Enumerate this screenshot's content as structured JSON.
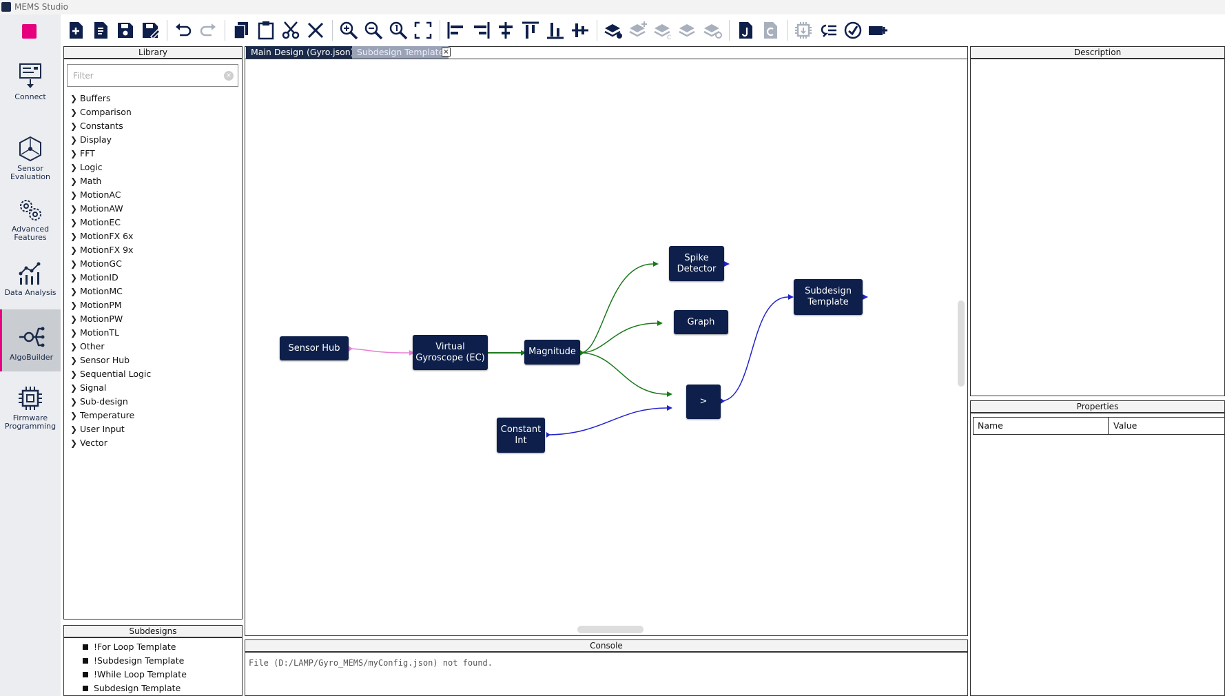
{
  "window": {
    "title": "MEMS Studio"
  },
  "nav": {
    "items": [
      {
        "label": "Connect",
        "icon": "connect-icon"
      },
      {
        "label": "Sensor Evaluation",
        "icon": "sensor-evaluation-icon"
      },
      {
        "label": "Advanced Features",
        "icon": "gears-icon"
      },
      {
        "label": "Data Analysis",
        "icon": "chart-icon"
      },
      {
        "label": "AlgoBuilder",
        "icon": "algobuilder-icon"
      },
      {
        "label": "Firmware Programming",
        "icon": "chip-icon"
      }
    ],
    "active": "AlgoBuilder",
    "accent": "#e6007e"
  },
  "toolbar": {
    "buttons": [
      "new-design-icon",
      "new-file-icon",
      "save-icon",
      "save-as-icon",
      "undo-icon",
      "redo-icon",
      "copy-icon",
      "paste-icon",
      "cut-icon",
      "delete-icon",
      "zoom-in-icon",
      "zoom-out-icon",
      "zoom-reset-icon",
      "fit-screen-icon",
      "align-left-icon",
      "align-right-icon",
      "align-center-h-icon",
      "align-top-icon",
      "align-bottom-icon",
      "align-center-v-icon",
      "layers-build-icon",
      "layers-add-icon",
      "layers-c-icon",
      "layers-icon",
      "layers-back-icon",
      "json-file-icon",
      "c-file-icon",
      "firmware-icon",
      "function-list-icon",
      "run-icon",
      "add-device-icon"
    ]
  },
  "library": {
    "header": "Library",
    "filter_placeholder": "Filter",
    "items": [
      "Buffers",
      "Comparison",
      "Constants",
      "Display",
      "FFT",
      "Logic",
      "Math",
      "MotionAC",
      "MotionAW",
      "MotionEC",
      "MotionFX 6x",
      "MotionFX 9x",
      "MotionGC",
      "MotionID",
      "MotionMC",
      "MotionPM",
      "MotionPW",
      "MotionTL",
      "Other",
      "Sensor Hub",
      "Sequential Logic",
      "Signal",
      "Sub-design",
      "Temperature",
      "User Input",
      "Vector"
    ]
  },
  "subdesigns": {
    "header": "Subdesigns",
    "items": [
      "!For Loop Template",
      "!Subdesign Template",
      "!While Loop Template",
      "Subdesign Template"
    ]
  },
  "tabs": [
    {
      "label": "Main Design (Gyro.json)",
      "active": true
    },
    {
      "label": "Subdesign Template",
      "active": false,
      "close": "×"
    }
  ],
  "nodes": {
    "sensor_hub": "Sensor Hub",
    "virtual_gyro_1": "Virtual",
    "virtual_gyro_2": "Gyroscope (EC)",
    "magnitude": "Magnitude",
    "spike_1": "Spike",
    "spike_2": "Detector",
    "graph": "Graph",
    "gt": ">",
    "constant_1": "Constant",
    "constant_2": "Int",
    "subdesign_1": "Subdesign",
    "subdesign_2": "Template"
  },
  "link_colors": {
    "pink": "#e67fd6",
    "green": "#1a7a1a",
    "blue": "#2222cc"
  },
  "console": {
    "header": "Console",
    "text": "File (D:/LAMP/Gyro_MEMS/myConfig.json) not found."
  },
  "description": {
    "header": "Description"
  },
  "properties": {
    "header": "Properties",
    "col_name": "Name",
    "col_value": "Value"
  }
}
